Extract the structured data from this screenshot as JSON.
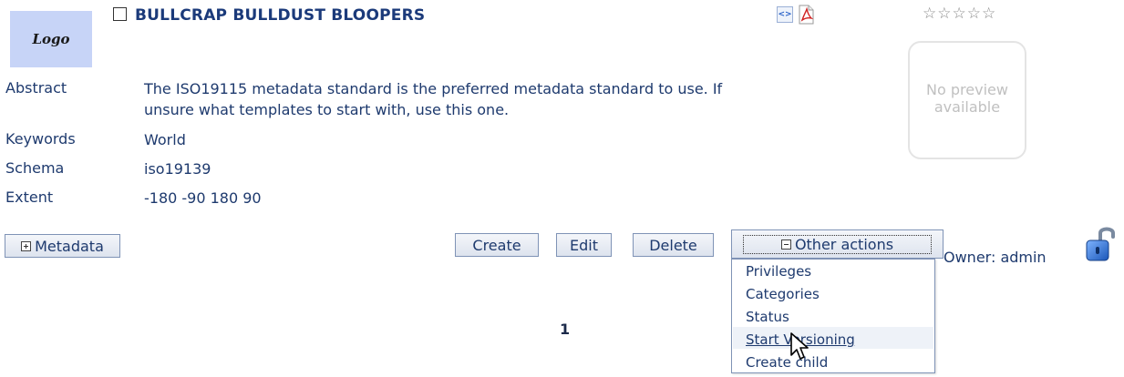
{
  "record": {
    "logo_text": "Logo",
    "title": "BULLCRAP BULLDUST BLOOPERS",
    "rating": "☆☆☆☆☆",
    "preview_line1": "No preview",
    "preview_line2": "available",
    "fields": {
      "abstract_label": "Abstract",
      "abstract_line1": "The ISO19115 metadata standard is the preferred metadata standard to use. If",
      "abstract_line2": "unsure what templates to start with, use this one.",
      "keywords_label": "Keywords",
      "keywords_value": "World",
      "schema_label": "Schema",
      "schema_value": "iso19139",
      "extent_label": "Extent",
      "extent_value": "-180 -90 180 90"
    },
    "owner_text": "Owner: admin"
  },
  "actions": {
    "metadata_label": "Metadata",
    "create_label": "Create",
    "edit_label": "Edit",
    "delete_label": "Delete",
    "other_actions_label": "Other actions",
    "menu": [
      "Privileges",
      "Categories",
      "Status",
      "Start Versioning",
      "Create child"
    ]
  },
  "pagination": {
    "current_page": "1"
  },
  "icons": {
    "xml": "xml-export-icon",
    "pdf": "pdf-export-icon",
    "lock": "unlocked-padlock-icon",
    "cursor": "mouse-pointer-icon"
  },
  "colors": {
    "text": "#1e3a6e",
    "logo_bg": "#c7d4f7",
    "button_border": "#7f93b6"
  }
}
